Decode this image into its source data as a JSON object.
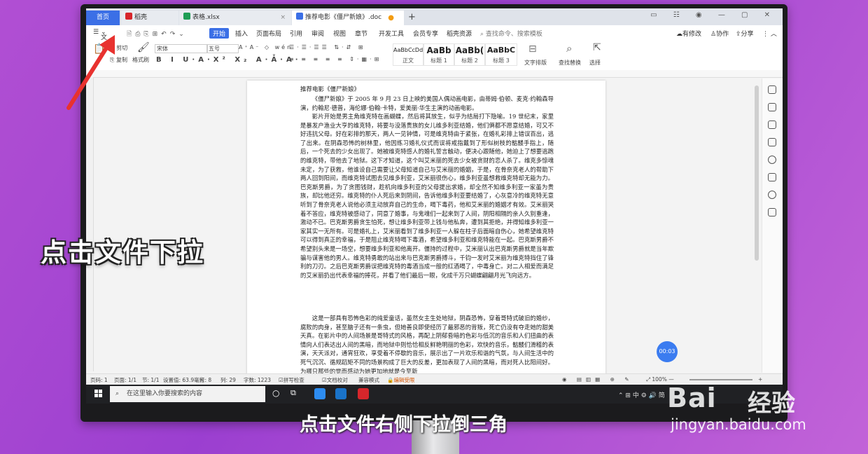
{
  "tabs": {
    "home": "首页",
    "t1": "稻壳",
    "t2": "表格.xlsx",
    "active": "推荐电影《僵尸新娘》.doc",
    "add": "+"
  },
  "menu": {
    "file": "文件",
    "start": "开始",
    "insert": "插入",
    "layout": "页面布局",
    "ref": "引用",
    "review": "审阅",
    "view": "视图",
    "chapter": "章节",
    "dev": "开发工具",
    "member": "会员专享",
    "docer": "稻壳资源",
    "search": "查找命令、搜索模板",
    "changes": "有修改",
    "collab": "协作",
    "share": "分享"
  },
  "ribbon": {
    "cut": "剪切",
    "copy": "复制",
    "painter": "格式刷",
    "font": "宋体",
    "size": "五号",
    "style_normal_sample": "AaBbCcDd",
    "style_normal": "正文",
    "style_h1_sample": "AaBb",
    "style_h1": "标题 1",
    "style_h2_sample": "AaBb(",
    "style_h2": "标题 2",
    "style_h3_sample": "AaBbC",
    "style_h3": "标题 3",
    "text_layout": "文字排版",
    "find_replace": "查找替换",
    "select": "选择"
  },
  "doc": {
    "title": "推荐电影《僵尸新娘》",
    "p1": "《僵尸新娘》于 2005 年 9 月 23 日上映的美国人偶动画电影，由蒂姆·伯顿、麦克·约翰森导演，约翰尼·德普，海伦娜·伯翰·卡特，爱美丽·华生主演的动画电影。",
    "p2": "影片开始是男主角维克特在画蝴蝶，然后将其放生，似乎为结局打下隐喻。19 世纪末，家里是暴发户渔业大亨的维克特，将要与没落贵族的女儿维多利亚结婚，他们俩都不愿意结婚，可又不好违抗父母。好在彩排的那天，两人一见钟情，可是维克特由于紧张，在婚礼彩排上错误百出，逃了出来。在阴森恐怖的树林里，他因练习婚礼仪式而误将戒指戴到了形似树枝的骷髅手指上，随后，一个死去的少女出现了。她被维克特感人的婚礼誓言触动，便决心跟随他，她迫上了想要逃跑的维克特，带他去了地狱。这下才知道，这个叫艾米丽的死去少女被贪财的恋人杀了。维克多惊魂未定，为了获救，他谁设自己需要让父母知道自己与艾米丽的婚姻，于是，在骨奈克老人的帮助下两人回到阳间，而维克特试图去见维多利亚，艾米丽很伤心，维多利亚虽想救维克特却无能为力。巴克斯男爵，为了贪图钱财，趁机向维多利亚的父母提出求婚，却全然不知维多利亚一家虽为贵族，却比他还穷。维克特的仆人死后来到阴间，告诉他维多利亚要结婚了，心灰意冷的维克特无意听到了骨奈克老人说他必须主动放弃自己的生命，喝下毒药，他和艾米丽的婚姻才有效。艾米丽哭着不答应，维克特被感动了，同意了婚事，与鬼魂们一起来到了人间，阴阳相隔的亲人久别重逢，激动不已。巴克斯男爵贪生怕死，想让维多利亚带上钱与他私奔，遭到其拒绝，并得知维多利亚一家其实一无所有。可是婚礼上，艾米丽看到了维多利亚一人躲在柱子后面暗自伤心，她希望维克特可以得到真正的幸福，于是阻止维克特喝下毒酒，希望维多利亚和维克特能在一起。巴克斯男爵不希望别头来是一场空，想要维多利亚和他离开。僵持的过程中，艾米丽认出巴克斯男爵就是当年欺骗与谋害他的男人。维克特勇敢的站出来与巴克斯男爵搏斗，千钧一发时艾米丽为维克特挡住了锋利的刀刃。之后巴克斯男爵误把维克特的毒酒当成一般的红酒喝了，中毒身亡。对二人相爱而满足的艾米丽扔出代表幸福的捧花，并看了他们最后一眼，化成千万只蝴蝶翩翩月光飞向远方。",
    "p3": "这是一部具有恐怖色彩的纯爱童话，虽然女主生处地狱，阴森恐怖，穿着哥特式破旧的婚纱，腐败的肉身，甚至脑子还有一条虫，但她善良即使经历了最邪恶的背叛，死亡仍没有夺走她的甜美天真。在影片中的人间场景是哥特式的风格，再配上阴郁昏暗的色彩与低沉的音乐和人们扭曲的表情向人们表达出人间的黑暗，而地狱中则恰恰相反鲜艳明丽的色彩，欢快的音乐，骷髅们滑稽的表演，天天派对，通宵狂欢，享受着不停歇的音乐，展示出了一片欢乐和谐的气氛，与人间生活中的死气沉沉、循规蹈矩不同的场景构成了巨大的反差，更加表现了人间的黑暗，而对死人比阳间好。为哪只那些的觉而感动为她更加地就是今至新"
  },
  "timer": "00:03",
  "status": {
    "page_no": "页码: 1",
    "pages": "页面: 1/1",
    "section": "节: 1/1",
    "setting": "设置值: 63.9毫米",
    "row": "行: 8",
    "col": "列: 29",
    "words": "字数: 1223",
    "spell": "拼写检查",
    "proof": "文档校对",
    "compat": "兼容模式",
    "encrypt": "编辑受限",
    "zoom": "100%"
  },
  "taskbar": {
    "search_placeholder": "在这里输入你要搜索的内容",
    "tray_text": "中",
    "tray_text2": "简"
  },
  "overlay": {
    "big": "点击文件下拉",
    "subtitle": "点击文件右侧下拉倒三角"
  },
  "watermark": {
    "brand1": "Bai",
    "brand2": "经验",
    "url": "jingyan.baidu.com"
  },
  "colors": {
    "accent": "#3b6fe6",
    "arrow": "#e8322f",
    "wps_red": "#d7262b"
  }
}
